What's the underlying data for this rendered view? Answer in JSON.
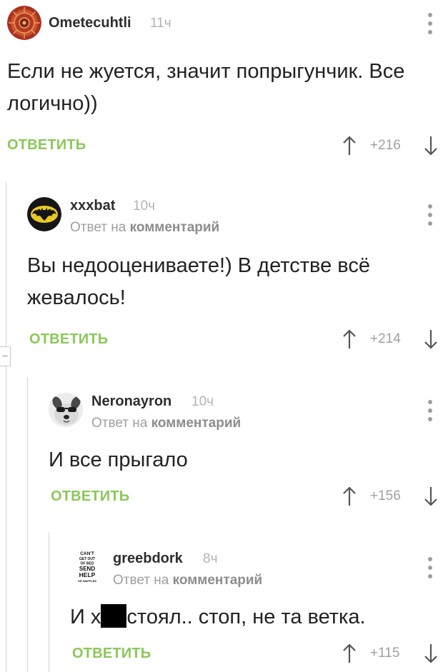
{
  "comments": [
    {
      "author": "Ometecuhtli",
      "time": "11ч",
      "avatar": "aztec-calendar-avatar",
      "text": "Если не жуется, значит попрыгунчик. Все логично))",
      "reply_label": "ОТВЕТИТЬ",
      "rating": "+216"
    },
    {
      "author": "xxxbat",
      "time": "10ч",
      "avatar": "batman-logo-avatar",
      "reply_prefix": "Ответ на",
      "reply_target": "комментарий",
      "text": "Вы недооцениваете!) В детстве всё жевалось!",
      "reply_label": "ОТВЕТИТЬ",
      "rating": "+214"
    },
    {
      "author": "Neronayron",
      "time": "10ч",
      "avatar": "dog-with-sunglasses-avatar",
      "reply_prefix": "Ответ на",
      "reply_target": "комментарий",
      "text": "И все прыгало",
      "reply_label": "ОТВЕТИТЬ",
      "rating": "+156"
    },
    {
      "author": "greebdork",
      "time": "8ч",
      "avatar": "cant-get-out-of-bed-send-help-avatar",
      "avatar_text": [
        "CAN'T",
        "GET OUT",
        "OF BED",
        "SEND",
        "HELP",
        "OR WAFFLES"
      ],
      "reply_prefix": "Ответ на",
      "reply_target": "комментарий",
      "text_before": "И х",
      "text_after": "стоял.. стоп, не та ветка.",
      "reply_label": "ОТВЕТИТЬ",
      "rating": "+115"
    }
  ],
  "colors": {
    "reply_button": "#8ac858",
    "time": "#b4b4b4",
    "rating": "#a0a0a0",
    "thread_line": "#d4d4d4",
    "background": "#ffffff"
  }
}
